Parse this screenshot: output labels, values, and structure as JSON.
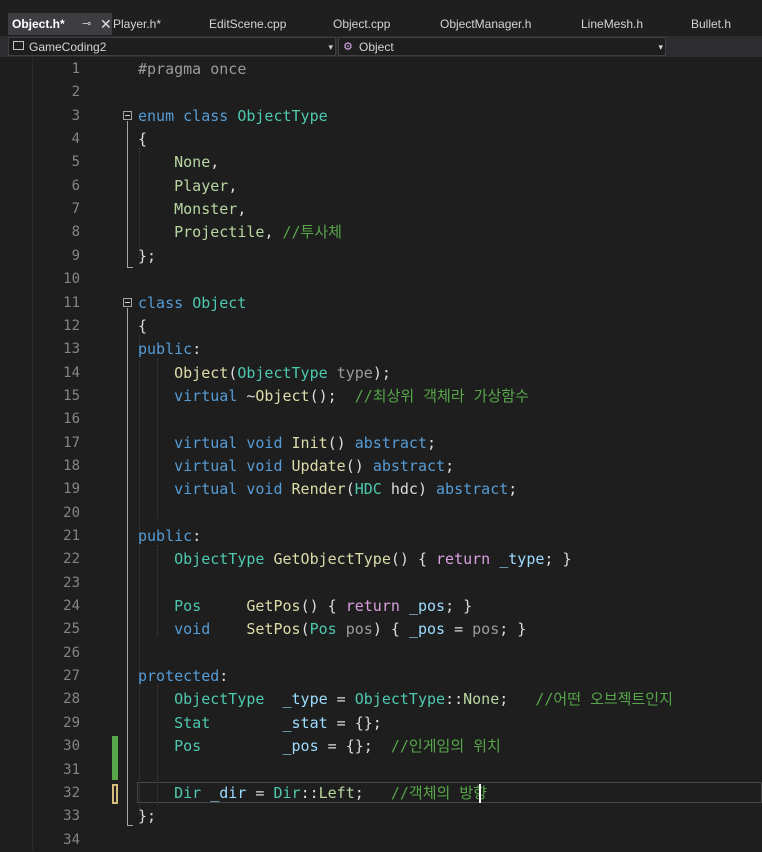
{
  "tabs": [
    {
      "label": "Object.h*",
      "active": true,
      "pin": "⊸",
      "close": "✕"
    },
    {
      "label": "Player.h*"
    },
    {
      "label": "EditScene.cpp"
    },
    {
      "label": "Object.cpp"
    },
    {
      "label": "ObjectManager.h"
    },
    {
      "label": "LineMesh.h"
    },
    {
      "label": "Bullet.h"
    }
  ],
  "nav": {
    "project": "GameCoding2",
    "scope": "Object",
    "dropdown_arrow": "▾"
  },
  "lines": [
    {
      "n": "1",
      "tokens": [
        [
          "#pragma once",
          "pp"
        ]
      ]
    },
    {
      "n": "2",
      "tokens": []
    },
    {
      "n": "3",
      "tokens": [
        [
          "enum class ",
          "kw"
        ],
        [
          "ObjectType",
          "ty"
        ]
      ]
    },
    {
      "n": "4",
      "tokens": [
        [
          "{",
          ""
        ]
      ]
    },
    {
      "n": "5",
      "tokens": [
        [
          "    ",
          ""
        ],
        [
          "None",
          "en"
        ],
        [
          ",",
          ""
        ]
      ]
    },
    {
      "n": "6",
      "tokens": [
        [
          "    ",
          ""
        ],
        [
          "Player",
          "en"
        ],
        [
          ",",
          ""
        ]
      ]
    },
    {
      "n": "7",
      "tokens": [
        [
          "    ",
          ""
        ],
        [
          "Monster",
          "en"
        ],
        [
          ",",
          ""
        ]
      ]
    },
    {
      "n": "8",
      "tokens": [
        [
          "    ",
          ""
        ],
        [
          "Projectile",
          "en"
        ],
        [
          ", ",
          ""
        ],
        [
          "//투사체",
          "cm"
        ]
      ]
    },
    {
      "n": "9",
      "tokens": [
        [
          "};",
          ""
        ]
      ]
    },
    {
      "n": "10",
      "tokens": []
    },
    {
      "n": "11",
      "tokens": [
        [
          "class ",
          "kw"
        ],
        [
          "Object",
          "ty"
        ]
      ]
    },
    {
      "n": "12",
      "tokens": [
        [
          "{",
          ""
        ]
      ]
    },
    {
      "n": "13",
      "tokens": [
        [
          "public",
          "kw"
        ],
        [
          ":",
          ""
        ]
      ]
    },
    {
      "n": "14",
      "tokens": [
        [
          "    ",
          ""
        ],
        [
          "Object",
          "fn"
        ],
        [
          "(",
          ""
        ],
        [
          "ObjectType",
          "ty"
        ],
        [
          " ",
          ""
        ],
        [
          "type",
          "pp"
        ],
        [
          ");",
          ""
        ]
      ]
    },
    {
      "n": "15",
      "tokens": [
        [
          "    ",
          ""
        ],
        [
          "virtual ",
          "kw"
        ],
        [
          "~",
          ""
        ],
        [
          "Object",
          "fn"
        ],
        [
          "();  ",
          ""
        ],
        [
          "//최상위 객체라 가상함수",
          "cm"
        ]
      ]
    },
    {
      "n": "16",
      "tokens": []
    },
    {
      "n": "17",
      "tokens": [
        [
          "    ",
          ""
        ],
        [
          "virtual void ",
          "kw"
        ],
        [
          "Init",
          "fn"
        ],
        [
          "() ",
          ""
        ],
        [
          "abstract",
          "kw"
        ],
        [
          ";",
          ""
        ]
      ]
    },
    {
      "n": "18",
      "tokens": [
        [
          "    ",
          ""
        ],
        [
          "virtual void ",
          "kw"
        ],
        [
          "Update",
          "fn"
        ],
        [
          "() ",
          ""
        ],
        [
          "abstract",
          "kw"
        ],
        [
          ";",
          ""
        ]
      ]
    },
    {
      "n": "19",
      "tokens": [
        [
          "    ",
          ""
        ],
        [
          "virtual void ",
          "kw"
        ],
        [
          "Render",
          "fn"
        ],
        [
          "(",
          ""
        ],
        [
          "HDC",
          "ty"
        ],
        [
          " hdc) ",
          ""
        ],
        [
          "abstract",
          "kw"
        ],
        [
          ";",
          ""
        ]
      ]
    },
    {
      "n": "20",
      "tokens": []
    },
    {
      "n": "21",
      "tokens": [
        [
          "public",
          "kw"
        ],
        [
          ":",
          ""
        ]
      ]
    },
    {
      "n": "22",
      "tokens": [
        [
          "    ",
          ""
        ],
        [
          "ObjectType ",
          "ty"
        ],
        [
          "GetObjectType",
          "fn"
        ],
        [
          "() { ",
          ""
        ],
        [
          "return ",
          "kw2"
        ],
        [
          "_type",
          "pm"
        ],
        [
          "; }",
          ""
        ]
      ]
    },
    {
      "n": "23",
      "tokens": []
    },
    {
      "n": "24",
      "tokens": [
        [
          "    ",
          ""
        ],
        [
          "Pos",
          "ty"
        ],
        [
          "     ",
          ""
        ],
        [
          "GetPos",
          "fn"
        ],
        [
          "() { ",
          ""
        ],
        [
          "return ",
          "kw2"
        ],
        [
          "_pos",
          "pm"
        ],
        [
          "; }",
          ""
        ]
      ]
    },
    {
      "n": "25",
      "tokens": [
        [
          "    ",
          ""
        ],
        [
          "void",
          "kw"
        ],
        [
          "    ",
          ""
        ],
        [
          "SetPos",
          "fn"
        ],
        [
          "(",
          ""
        ],
        [
          "Pos",
          "ty"
        ],
        [
          " ",
          ""
        ],
        [
          "pos",
          "pp"
        ],
        [
          ") { ",
          ""
        ],
        [
          "_pos",
          "pm"
        ],
        [
          " = ",
          ""
        ],
        [
          "pos",
          "pp"
        ],
        [
          "; }",
          ""
        ]
      ]
    },
    {
      "n": "26",
      "tokens": []
    },
    {
      "n": "27",
      "tokens": [
        [
          "protected",
          "kw"
        ],
        [
          ":",
          ""
        ]
      ]
    },
    {
      "n": "28",
      "tokens": [
        [
          "    ",
          ""
        ],
        [
          "ObjectType",
          "ty"
        ],
        [
          "  ",
          ""
        ],
        [
          "_type",
          "pm"
        ],
        [
          " = ",
          ""
        ],
        [
          "ObjectType",
          "ty"
        ],
        [
          "::",
          ""
        ],
        [
          "None",
          "en"
        ],
        [
          ";   ",
          ""
        ],
        [
          "//어떤 오브젝트인지",
          "cm"
        ]
      ]
    },
    {
      "n": "29",
      "tokens": [
        [
          "    ",
          ""
        ],
        [
          "Stat",
          "ty"
        ],
        [
          "        ",
          ""
        ],
        [
          "_stat",
          "pm"
        ],
        [
          " = {};",
          ""
        ]
      ]
    },
    {
      "n": "30",
      "tokens": [
        [
          "    ",
          ""
        ],
        [
          "Pos",
          "ty"
        ],
        [
          "         ",
          ""
        ],
        [
          "_pos",
          "pm"
        ],
        [
          " = {};  ",
          ""
        ],
        [
          "//인게임의 위치",
          "cm"
        ]
      ]
    },
    {
      "n": "31",
      "tokens": []
    },
    {
      "n": "32",
      "tokens": [
        [
          "    ",
          ""
        ],
        [
          "Dir",
          "ty"
        ],
        [
          " ",
          ""
        ],
        [
          "_dir",
          "pm"
        ],
        [
          " = ",
          ""
        ],
        [
          "Dir",
          "ty"
        ],
        [
          "::",
          ""
        ],
        [
          "Left",
          "en"
        ],
        [
          ";   ",
          ""
        ],
        [
          "//객체의 방향",
          "cm"
        ]
      ]
    },
    {
      "n": "33",
      "tokens": [
        [
          "};",
          ""
        ]
      ]
    },
    {
      "n": "34",
      "tokens": []
    }
  ],
  "colors": {
    "keyword": "#569cd6",
    "type": "#4ec9b0",
    "function": "#dcdcaa",
    "comment": "#57a64a",
    "enum_member": "#b8d7a3",
    "change_saved": "#57a64a",
    "change_unsaved": "#d7ba7d"
  }
}
